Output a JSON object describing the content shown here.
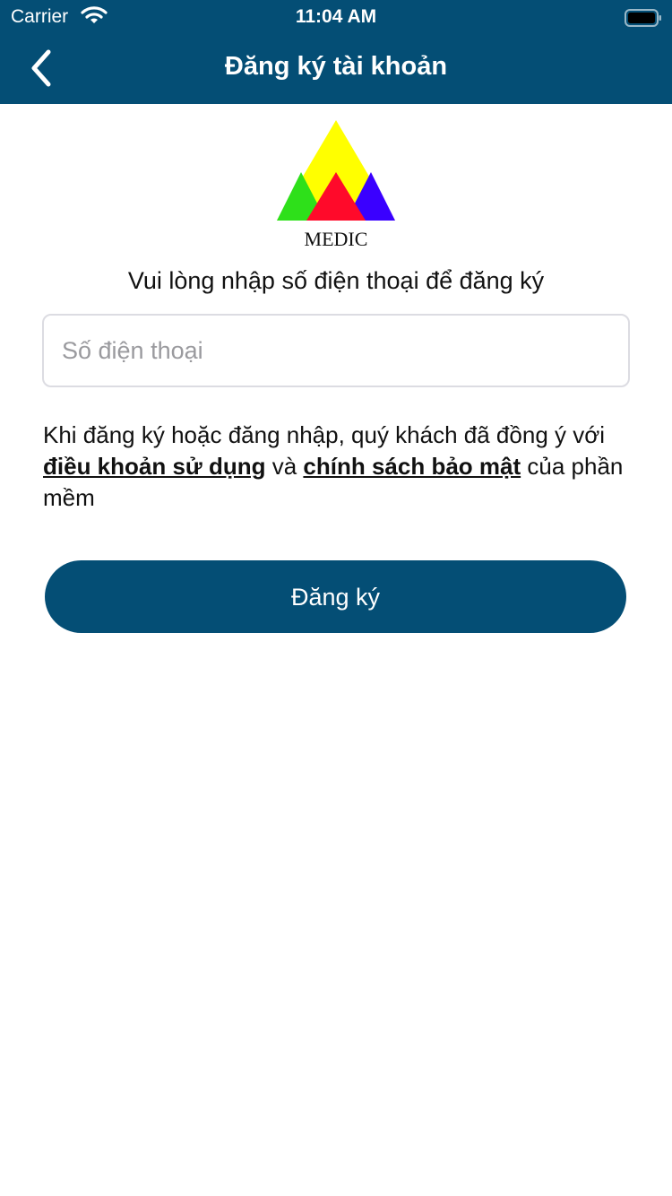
{
  "status_bar": {
    "carrier": "Carrier",
    "time": "11:04 AM"
  },
  "nav": {
    "title": "Đăng ký tài khoản",
    "back_icon": "chevron-left-icon"
  },
  "logo": {
    "text": "MEDIC",
    "colors": {
      "top": "#ffff00",
      "left": "#2ee01a",
      "center": "#ff0a2a",
      "right": "#3a00ff"
    }
  },
  "form": {
    "prompt": "Vui lòng nhập số điện thoại để đăng ký",
    "phone_placeholder": "Số điện thoại",
    "phone_value": "",
    "terms_prefix": "Khi đăng ký hoặc đăng nhập, quý khách đã đồng ý với ",
    "terms_link": "điều khoản sử dụng",
    "terms_and": " và ",
    "privacy_link": "chính sách bảo mật",
    "terms_suffix": " của phần mềm",
    "submit_label": "Đăng ký"
  },
  "theme": {
    "primary": "#044e75",
    "background": "#ffffff"
  }
}
